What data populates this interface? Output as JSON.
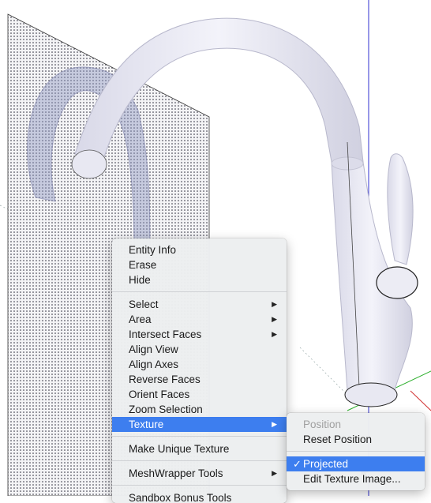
{
  "context_menu": {
    "items": [
      {
        "label": "Entity Info"
      },
      {
        "label": "Erase"
      },
      {
        "label": "Hide"
      },
      {
        "label": "Select"
      },
      {
        "label": "Area"
      },
      {
        "label": "Intersect Faces"
      },
      {
        "label": "Align View"
      },
      {
        "label": "Align Axes"
      },
      {
        "label": "Reverse Faces"
      },
      {
        "label": "Orient Faces"
      },
      {
        "label": "Zoom Selection"
      },
      {
        "label": "Texture"
      },
      {
        "label": "Make Unique Texture"
      },
      {
        "label": "MeshWrapper Tools"
      },
      {
        "label": "Sandbox Bonus Tools"
      }
    ],
    "submenu_arrow_glyph": "▶"
  },
  "texture_submenu": {
    "items": [
      {
        "label": "Position"
      },
      {
        "label": "Reset Position"
      },
      {
        "label": "Projected"
      },
      {
        "label": "Edit Texture Image..."
      }
    ],
    "check_glyph": "✓"
  },
  "colors": {
    "highlight": "#3d7eef",
    "axis_blue": "#2f2fd0",
    "axis_green": "#2fb02f",
    "axis_red": "#d03030"
  },
  "icons": [
    "submenu-arrow-icon",
    "checkmark-icon",
    "mouse-cursor-icon"
  ]
}
